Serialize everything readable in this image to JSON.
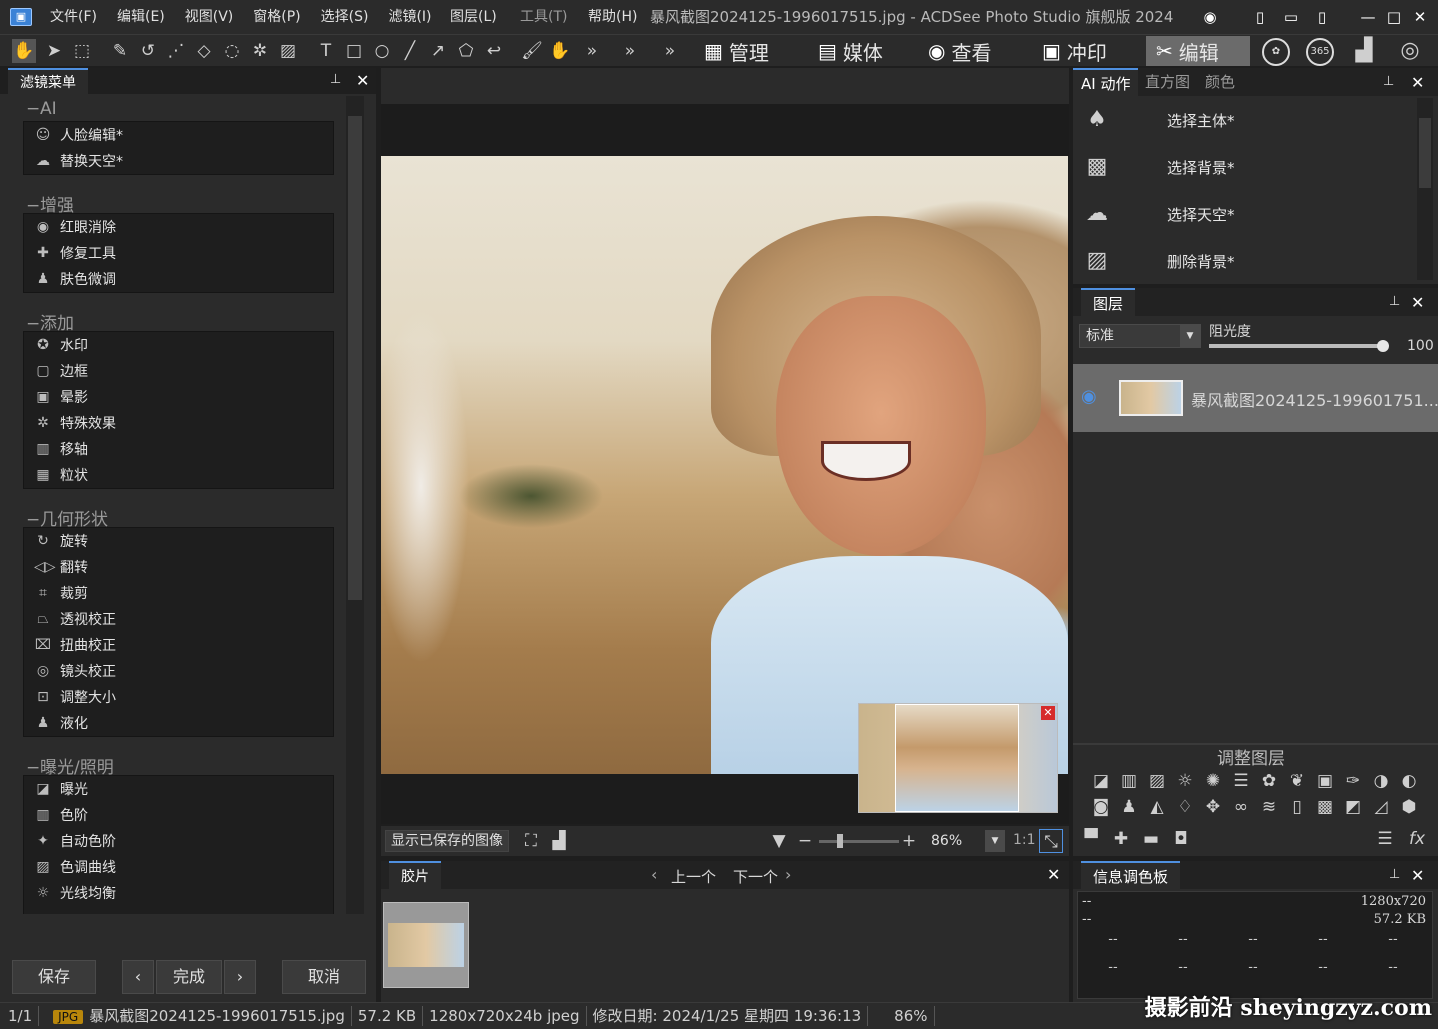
{
  "menubar": {
    "items": [
      "文件(F)",
      "编辑(E)",
      "视图(V)",
      "窗格(P)",
      "选择(S)",
      "滤镜(I)",
      "图层(L)",
      "工具(T)",
      "帮助(H)"
    ],
    "title": "暴风截图2024125-1996017515.jpg - ACDSee Photo Studio 旗舰版 2024"
  },
  "modes": {
    "manage": "管理",
    "media": "媒体",
    "view": "查看",
    "develop": "冲印",
    "edit": "编辑",
    "badge365": "365"
  },
  "filter_panel": {
    "tab": "滤镜菜单",
    "groups": [
      {
        "title": "AI",
        "items": [
          "人脸编辑*",
          "替换天空*"
        ]
      },
      {
        "title": "增强",
        "items": [
          "红眼消除",
          "修复工具",
          "肤色微调"
        ]
      },
      {
        "title": "添加",
        "items": [
          "水印",
          "边框",
          "晕影",
          "特殊效果",
          "移轴",
          "粒状"
        ]
      },
      {
        "title": "几何形状",
        "items": [
          "旋转",
          "翻转",
          "裁剪",
          "透视校正",
          "扭曲校正",
          "镜头校正",
          "调整大小",
          "液化"
        ]
      },
      {
        "title": "曝光/照明",
        "items": [
          "曝光",
          "色阶",
          "自动色阶",
          "色调曲线",
          "光线均衡"
        ]
      }
    ],
    "save": "保存",
    "done": "完成",
    "cancel": "取消"
  },
  "viewbar": {
    "show_saved": "显示已保存的图像",
    "zoom": "86%",
    "one_to_one": "1:1"
  },
  "filmstrip": {
    "tab": "胶片",
    "prev": "上一个",
    "next": "下一个"
  },
  "ai_panel": {
    "tabs": [
      "AI 动作",
      "直方图",
      "颜色"
    ],
    "actions": [
      "选择主体*",
      "选择背景*",
      "选择天空*",
      "删除背景*"
    ]
  },
  "layers": {
    "tab": "图层",
    "blend_mode": "标准",
    "opacity_label": "阻光度",
    "opacity_value": "100",
    "opacity": 1.0,
    "layer_name": "暴风截图2024125-199601751..."
  },
  "adjust": {
    "title": "调整图层"
  },
  "info": {
    "tab": "信息调色板",
    "dims": "1280x720",
    "size": "57.2 KB",
    "dash": "--"
  },
  "status": {
    "index": "1/1",
    "format": "JPG",
    "filename": "暴风截图2024125-1996017515.jpg",
    "filesize": "57.2 KB",
    "pixels": "1280x720x24b jpeg",
    "modified": "修改日期: 2024/1/25 星期四 19:36:13",
    "zoom": "86%"
  },
  "watermark": "摄影前沿 sheyingzyz.com",
  "colors": {
    "accent": "#4f90e0",
    "panel": "#2b2b2b",
    "active_mode": "#6b6b6b"
  }
}
